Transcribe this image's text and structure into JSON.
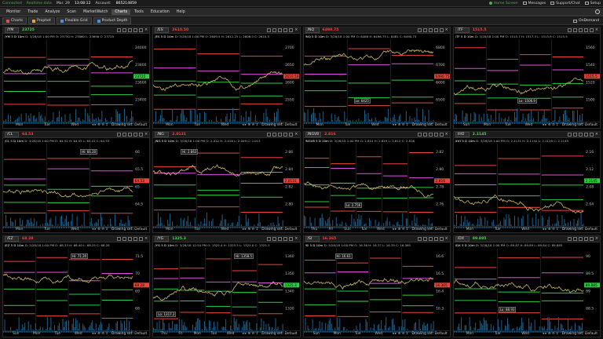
{
  "topbar": {
    "connected": "Connected",
    "realtime": "Realtime data",
    "date": "Mar. 29",
    "time": "13:08:12",
    "account_label": "Account:",
    "account": "865214859",
    "home_screen": "Home Screen",
    "messages": "Messages",
    "support": "Support/Chat",
    "setup": "Setup"
  },
  "menu": [
    "Monitor",
    "Trade",
    "Analyze",
    "Scan",
    "MarketWatch",
    "Charts",
    "Tools",
    "Education",
    "Help"
  ],
  "menu_active": "Charts",
  "subbar": {
    "tabs": [
      {
        "label": "Charts",
        "color": "#d9534f"
      },
      {
        "label": "Prophet",
        "color": "#e6a23c"
      },
      {
        "label": "Flexible Grid",
        "color": "#4a90e2"
      },
      {
        "label": "Product Depth",
        "color": "#4a90e2"
      }
    ],
    "ondemand": "OnDemand"
  },
  "footer_common": {
    "drawing_set": "Drawing set: Default",
    "nav": "◂ ▸ ⊕ ⊖ ↕"
  },
  "charts": [
    {
      "symbol": "/YM",
      "price": "23725",
      "dir": "up",
      "title": "/YM 5 D 10m",
      "info": "D: 3/28/18 1:00 PM  O: 23730  H: 23860  L: 23696  C: 23725",
      "days": [
        "Mon",
        "Tue",
        "Wed"
      ],
      "axis": [
        "24000",
        "23800",
        "23600",
        "23400"
      ]
    },
    {
      "symbol": "/ES",
      "price": "2610.50",
      "dir": "down",
      "title": "/ES 5 D 10m",
      "info": "D: 3/28/18 1:00 PM  O: 2609.5  H: 2612.25  L: 2608.5  C: 2610.5",
      "days": [
        "Mon",
        "Tue",
        "Wed"
      ],
      "axis": [
        "2700",
        "2650",
        "2600",
        "2550"
      ]
    },
    {
      "symbol": "/NQ",
      "price": "6490.75",
      "dir": "down",
      "title": "/NQ 5 D 10m",
      "info": "D: 3/28/18 1:00 PM  O: 6488  H: 6496.75  L: 6481  C: 6490.75",
      "days": [
        "Mon",
        "Tue",
        "Wed"
      ],
      "axis": [
        "6800",
        "6700",
        "6600",
        "6500"
      ],
      "label": "Lo: 6425"
    },
    {
      "symbol": "/TF",
      "price": "1515.5",
      "dir": "down",
      "title": "/TF 5 D 10m",
      "info": "D: 3/28/18 1:00 PM  O: 1515.7  H: 1517.3  L: 1513.9  C: 1515.5",
      "days": [
        "Sun",
        "Mon",
        "Tue",
        "Wed"
      ],
      "axis": [
        "1560",
        "1540",
        "1520",
        "1500"
      ],
      "label": "Lo: 1506.9"
    },
    {
      "symbol": "/CL",
      "price": "64.53",
      "dir": "down",
      "title": "/CL 5 D 10m",
      "info": "D: 3/28/18 1:00 PM  O: 64.52  H: 64.55  L: 64.41  C: 64.53",
      "days": [
        "Mon",
        "Tue",
        "Wed"
      ],
      "axis": [
        "66",
        "65.5",
        "65",
        "64.5"
      ],
      "label": "Hi: 66.20"
    },
    {
      "symbol": "/NG",
      "price": "2.0131",
      "dir": "down",
      "title": "/NG 5 D 10m",
      "info": "D: 3/28/18 1:00 PM  O: 2.012  H: 2.016  L: 2.009  C: 2.013",
      "days": [
        "Mon",
        "Tue",
        "Wed"
      ],
      "axis": [
        "2.86",
        "2.84",
        "2.82",
        "2.80"
      ],
      "label": "Hi: 2.863"
    },
    {
      "symbol": "/NGV8",
      "price": "2.816",
      "dir": "down",
      "title": "/NGV8 5 D 10m",
      "info": "D: 3/28/18 1:00 PM  O: 2.814  H: 2.819  L: 2.812  C: 2.816",
      "days": [
        "Thu",
        "Fri",
        "Sun",
        "Tue",
        "Wed"
      ],
      "axis": [
        "2.82",
        "2.80",
        "2.78",
        "2.76"
      ],
      "label": "Lo: 2.756"
    },
    {
      "symbol": "/HO",
      "price": "2.1145",
      "dir": "up",
      "title": "/HO 5 D 10m",
      "info": "D: 3/28/18 1:00 PM  O: 2.1131  H: 2.1152  L: 2.1128  C: 2.1145",
      "days": [
        "Mon",
        "Tue",
        "Wed"
      ],
      "axis": [
        "2.16",
        "2.12",
        "2.08",
        "2.04"
      ]
    },
    {
      "symbol": "/EZ",
      "price": "68.28",
      "dir": "down",
      "title": "/EZ 5 D 10m",
      "info": "D: 3/28/18 1:00 PM  O: 68.33  H: 68.40  L: 68.25  C: 68.28",
      "days": [
        "Sun",
        "Mon",
        "Tue",
        "Wed"
      ],
      "axis": [
        "71.5",
        "70",
        "69",
        "68"
      ],
      "label": "Hi: 71.20"
    },
    {
      "symbol": "/YG",
      "price": "1325.3",
      "dir": "up",
      "title": "/YG 5 D 10m",
      "info": "D: 3/28/18 12:50 PM  O: 1325.4  H: 1325.5  L: 1325.0  C: 1325.3",
      "days": [
        "Thu",
        "Fri",
        "Mon",
        "Tue",
        "Wed"
      ],
      "axis": [
        "1360",
        "1350",
        "1340",
        "1330"
      ],
      "label": "Hi: 1358.5",
      "label2": "Lo: 1317.2"
    },
    {
      "symbol": "/SI",
      "price": "16.365",
      "dir": "down",
      "title": "/SI 5 D 10m",
      "info": "D: 3/28/18 1:00 PM  O: 16.36  H: 16.37  L: 16.35  C: 16.365",
      "days": [
        "Sun",
        "Mon",
        "Tue",
        "Wed"
      ],
      "axis": [
        "16.6",
        "16.5",
        "16.4",
        "16.3"
      ],
      "label": "Hi: 16.61"
    },
    {
      "symbol": "/DX",
      "price": "89.885",
      "dir": "up",
      "title": "/DX 5 D 10m",
      "info": "D: 3/28/18 1:00 PM  O: 89.87  H: 89.89  L: 89.84  C: 89.885",
      "days": [
        "Mon",
        "Tue",
        "Wed"
      ],
      "axis": [
        "90",
        "89.5",
        "89",
        "88.5"
      ],
      "label": "Lo: 88.93"
    }
  ]
}
